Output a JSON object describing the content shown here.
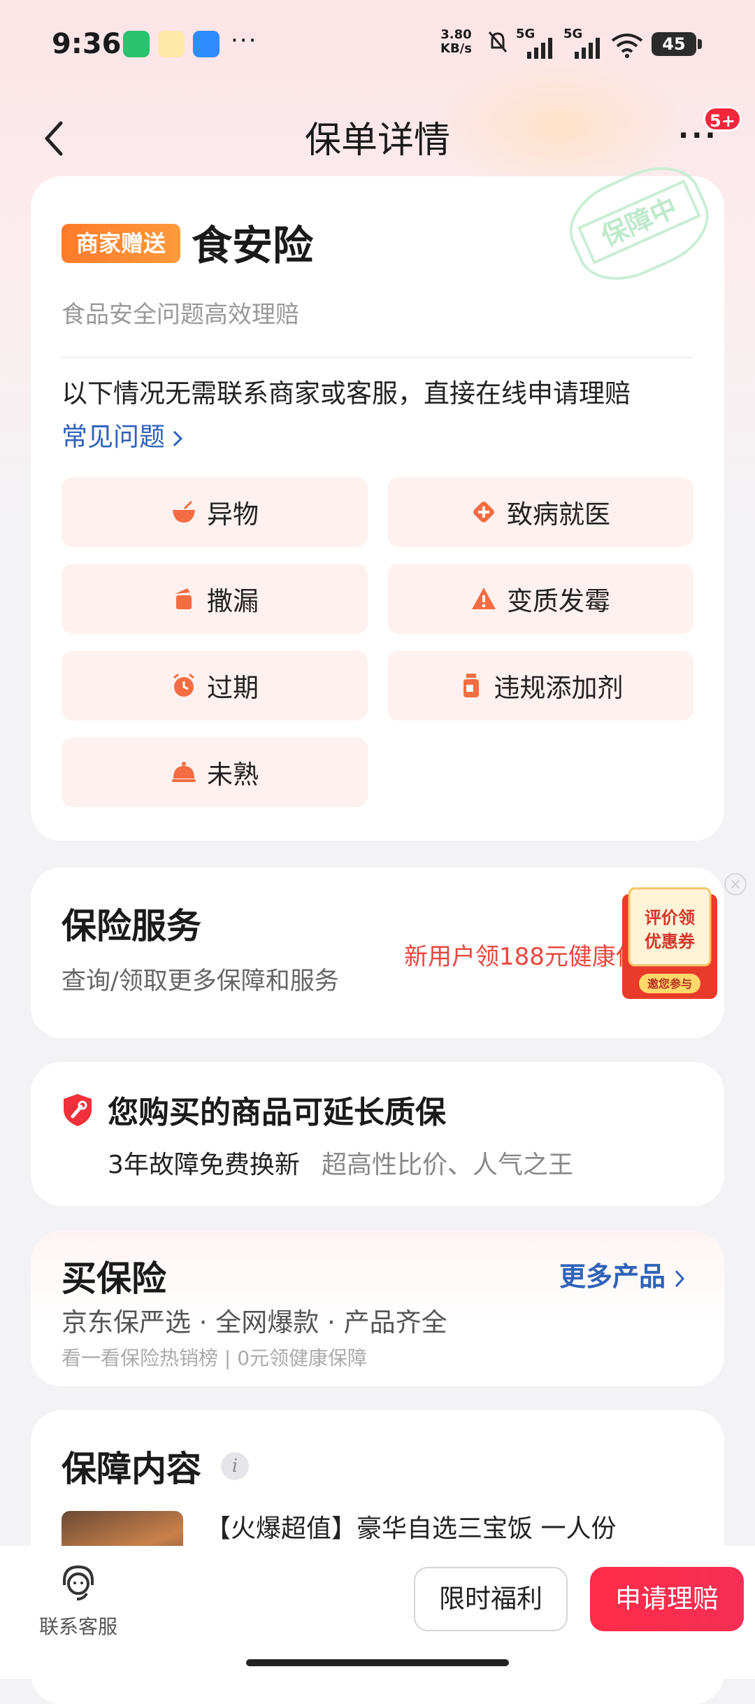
{
  "status_bar": {
    "time": "9:36",
    "net_speed_value": "3.80",
    "net_speed_unit": "KB/s",
    "net1": "5G",
    "net2": "5G",
    "battery": "45",
    "more_dots": "···"
  },
  "nav": {
    "title": "保单详情",
    "more_badge": "5+"
  },
  "policy": {
    "badge": "商家赠送",
    "name": "食安险",
    "stamp": "保障中",
    "subtitle": "食品安全问题高效理赔",
    "desc": "以下情况无需联系商家或客服，直接在线申请理赔",
    "faq_link": "常见问题",
    "items": [
      {
        "label": "异物",
        "icon": "bowl-icon"
      },
      {
        "label": "致病就医",
        "icon": "medical-plus-icon"
      },
      {
        "label": "撒漏",
        "icon": "spill-cup-icon"
      },
      {
        "label": "变质发霉",
        "icon": "warning-icon"
      },
      {
        "label": "过期",
        "icon": "alarm-clock-icon"
      },
      {
        "label": "违规添加剂",
        "icon": "bottle-icon"
      },
      {
        "label": "未熟",
        "icon": "cloche-icon"
      }
    ]
  },
  "service": {
    "title": "保险服务",
    "subtitle": "查询/领取更多保障和服务",
    "promo_text": "新用户领188元健康保",
    "promo_card_line1": "评价领",
    "promo_card_line2": "优惠券",
    "promo_card_button": "邀您参与"
  },
  "warranty": {
    "title": "您购买的商品可延长质保",
    "sub1": "3年故障免费换新",
    "sub2": "超高性比价、人气之王"
  },
  "buy": {
    "title": "买保险",
    "more": "更多产品",
    "subtitle": "京东保严选 · 全网爆款 · 产品齐全",
    "tip": "看一看保险热销榜 | 0元领健康保障"
  },
  "coverage": {
    "title": "保障内容",
    "info": "i",
    "product_name": "【火爆超值】豪华自选三宝饭 一人份"
  },
  "bottom_bar": {
    "customer_service": "联系客服",
    "welfare": "限时福利",
    "claim": "申请理赔"
  },
  "colors": {
    "accent_red": "#f52f55",
    "orange": "#ff7a2a",
    "link_blue": "#2f62b8",
    "tile_bg": "#fff1ef",
    "icon_orange": "#f46c42"
  }
}
